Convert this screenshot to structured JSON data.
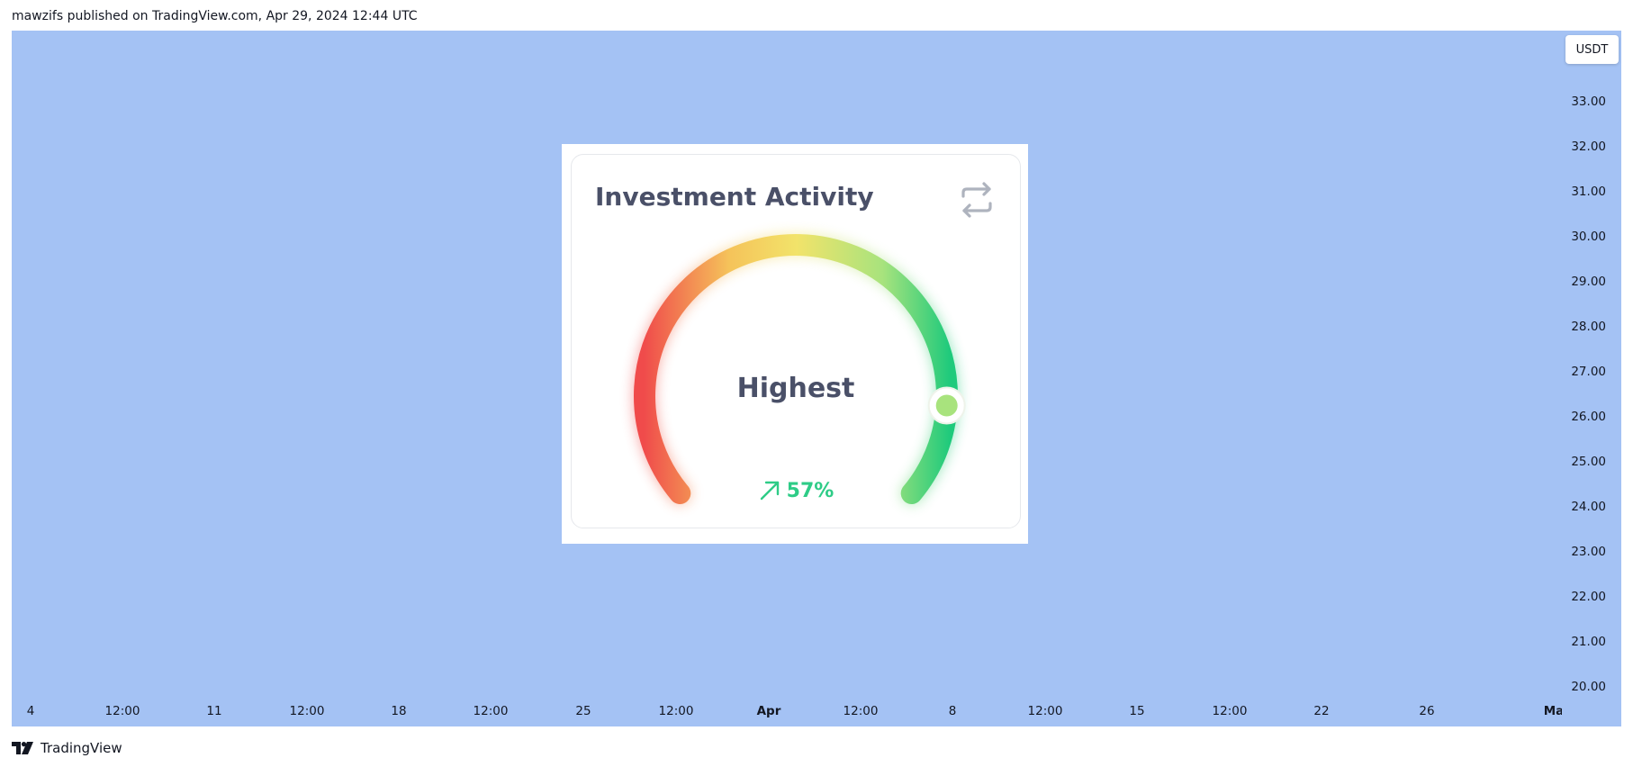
{
  "header": {
    "publish_text": "mawzifs published on TradingView.com, Apr 29, 2024 12:44 UTC"
  },
  "chart": {
    "background_color": "#a4c2f4",
    "currency": "USDT",
    "price_axis": [
      "33.00",
      "32.00",
      "31.00",
      "30.00",
      "29.00",
      "28.00",
      "27.00",
      "26.00",
      "25.00",
      "24.00",
      "23.00",
      "22.00",
      "21.00",
      "20.00"
    ],
    "time_axis": [
      {
        "label": "4",
        "major": false
      },
      {
        "label": "12:00",
        "major": false
      },
      {
        "label": "11",
        "major": false
      },
      {
        "label": "12:00",
        "major": false
      },
      {
        "label": "18",
        "major": false
      },
      {
        "label": "12:00",
        "major": false
      },
      {
        "label": "25",
        "major": false
      },
      {
        "label": "12:00",
        "major": false
      },
      {
        "label": "Apr",
        "major": true
      },
      {
        "label": "12:00",
        "major": false
      },
      {
        "label": "8",
        "major": false
      },
      {
        "label": "12:00",
        "major": false
      },
      {
        "label": "15",
        "major": false
      },
      {
        "label": "12:00",
        "major": false
      },
      {
        "label": "22",
        "major": false
      },
      {
        "label": "26",
        "major": false
      },
      {
        "label": "Ma",
        "major": true
      }
    ]
  },
  "widget": {
    "title": "Investment Activity",
    "status_label": "Highest",
    "change_value": "57%",
    "change_color": "#2ecc87",
    "gauge_level_percent": 86,
    "gauge_colors": [
      "#f04b4b",
      "#f5c35a",
      "#f2e36a",
      "#a8e37d",
      "#1fca7c"
    ],
    "icons": {
      "refresh": "refresh-icon",
      "trend": "arrow-up-right-icon"
    }
  },
  "footer": {
    "brand": "TradingView",
    "logo": "tradingview-logo-icon"
  }
}
